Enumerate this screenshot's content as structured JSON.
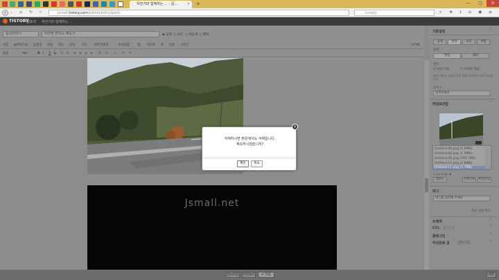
{
  "browser": {
    "tab_title": "자전거와 함께하는 ... - 글...",
    "tab_close": "×",
    "new_tab": "+",
    "window_controls": [
      "—",
      "□",
      "×"
    ],
    "url_prefix": "jsmall.",
    "url_domain": "tistory.com",
    "url_path": "/admin/entry/post/",
    "search_placeholder": "Google",
    "accent_color": "#d9b85a"
  },
  "tistory": {
    "logo": "TISTORY",
    "nav_item": "글쓰기",
    "blog_name": "자전거와 함께하는 ..."
  },
  "editor": {
    "category": "일상이야기",
    "title": "이천방 반도드 액소가...",
    "visibility_options": [
      "공개",
      "보호",
      "비공개",
      "예약"
    ],
    "toolbar1": [
      "사진",
      "슬라이드쇼",
      "동영상",
      "파일",
      "지도",
      "음악",
      "코드",
      "외부컨텐츠",
      "수식입력",
      "맵",
      "미디어",
      "표",
      "인용",
      "구분선",
      "HTML"
    ],
    "font": "돋움",
    "font_size": "9pt",
    "watermark": "Jsmall.net"
  },
  "sidebar": {
    "section_basic": "기본설정",
    "tabs": [
      "공개",
      "발행",
      "보호",
      "비밀"
    ],
    "category_label": "발행",
    "category_buttons": [
      "발행",
      "예약"
    ],
    "permission_label": "권한",
    "allow_comment": "댓글 허용",
    "allow_trackback": "트랙백 허용",
    "permission_note": "블로그에 글 공개된 경우 글을 관리하고 수정 가능합니다.",
    "address_label": "글주소",
    "address_value": "입력하세요",
    "file_section": "파일보관함",
    "files": [
      "Untitled-06.png (1.9MB)",
      "Untitled-08.png (1.9MB)",
      "Untitled-09.png (765.7KB)",
      "Untitled-10.png (1.8MB)",
      "Untitled-11.png (1.7MB)"
    ],
    "file_actions": [
      "업로드",
      "전체선택",
      "파일삽입"
    ],
    "tag_label": "태그",
    "tag_placeholder": "태그를 입력해 주세요",
    "tag_recent": "최근 사용 태그",
    "trackback": "트랙백",
    "ccl": "CCL",
    "location": "플레그인",
    "last_section": "작성완료 글",
    "last_select": "선택 안함"
  },
  "footer": {
    "save_temp": "임시저장",
    "preview": "미리보기",
    "publish": "✔ 저장",
    "top": "위로"
  },
  "dialog": {
    "line1": "삭제하시면 본문에서도 삭제됩니다.",
    "line2": "계속하시겠습니까?",
    "confirm": "확인",
    "cancel": "취소",
    "close": "×"
  }
}
